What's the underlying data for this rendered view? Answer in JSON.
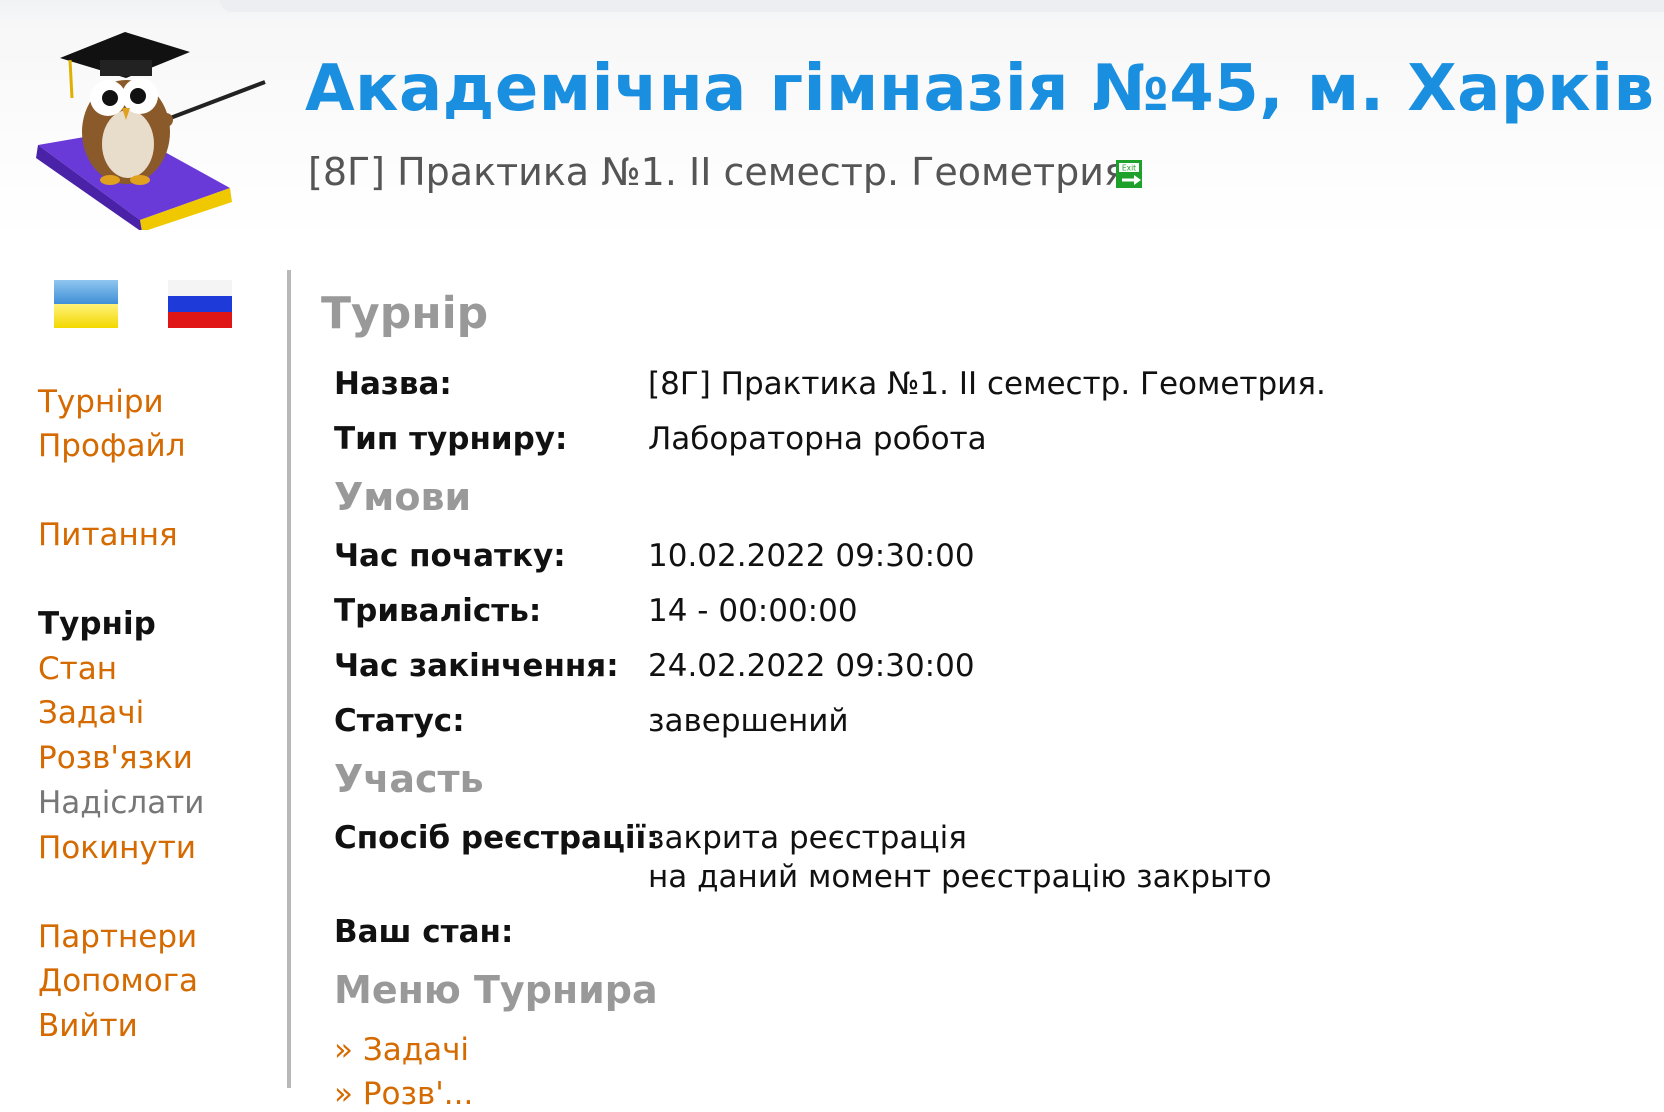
{
  "site": {
    "title": "Академічна гімназія №45, м. Харків",
    "subtitle": "[8Г] Практика №1. II семестр. Геометрия."
  },
  "icons": {
    "logo": "owl-on-book-logo",
    "exit": "exit-door-icon",
    "flag_ua": "ukraine-flag-icon",
    "flag_ru": "russia-flag-icon"
  },
  "colors": {
    "title": "#1a8fe0",
    "link": "#d46a00",
    "heading": "#999999",
    "text": "#111111"
  },
  "sidebar": {
    "items": [
      {
        "label": "Турніри",
        "state": "link"
      },
      {
        "label": "Профайл",
        "state": "link"
      },
      {
        "label": "Питання",
        "state": "link"
      },
      {
        "label": "Турнір",
        "state": "active"
      },
      {
        "label": "Стан",
        "state": "link"
      },
      {
        "label": "Задачі",
        "state": "link"
      },
      {
        "label": "Розв'язки",
        "state": "link"
      },
      {
        "label": "Надіслати",
        "state": "disabled"
      },
      {
        "label": "Покинути",
        "state": "link"
      },
      {
        "label": "Партнери",
        "state": "link"
      },
      {
        "label": "Допомога",
        "state": "link"
      },
      {
        "label": "Вийти",
        "state": "link"
      }
    ]
  },
  "main": {
    "heading": "Турнір",
    "rows": {
      "name": {
        "label": "Назва:",
        "value": "[8Г] Практика №1. II семестр. Геометрия."
      },
      "type": {
        "label": "Тип турниру:",
        "value": "Лабораторна робота"
      }
    },
    "conditions": {
      "heading": "Умови",
      "start": {
        "label": "Час початку:",
        "value": "10.02.2022 09:30:00"
      },
      "duration": {
        "label": "Тривалість:",
        "value": "14 - 00:00:00"
      },
      "end": {
        "label": "Час закінчення:",
        "value": "24.02.2022 09:30:00"
      },
      "status": {
        "label": "Статус:",
        "value": "завершений"
      }
    },
    "participation": {
      "heading": "Участь",
      "registration": {
        "label": "Спосіб реєстрації:",
        "value": "закрита реєстрація",
        "note": "на даний момент реєстрацію закрыто"
      },
      "your_state": {
        "label": "Ваш стан:",
        "value": ""
      }
    },
    "tournament_menu": {
      "heading": "Меню Турнира",
      "items": [
        "» Задачі",
        "» Розв'..."
      ]
    }
  }
}
